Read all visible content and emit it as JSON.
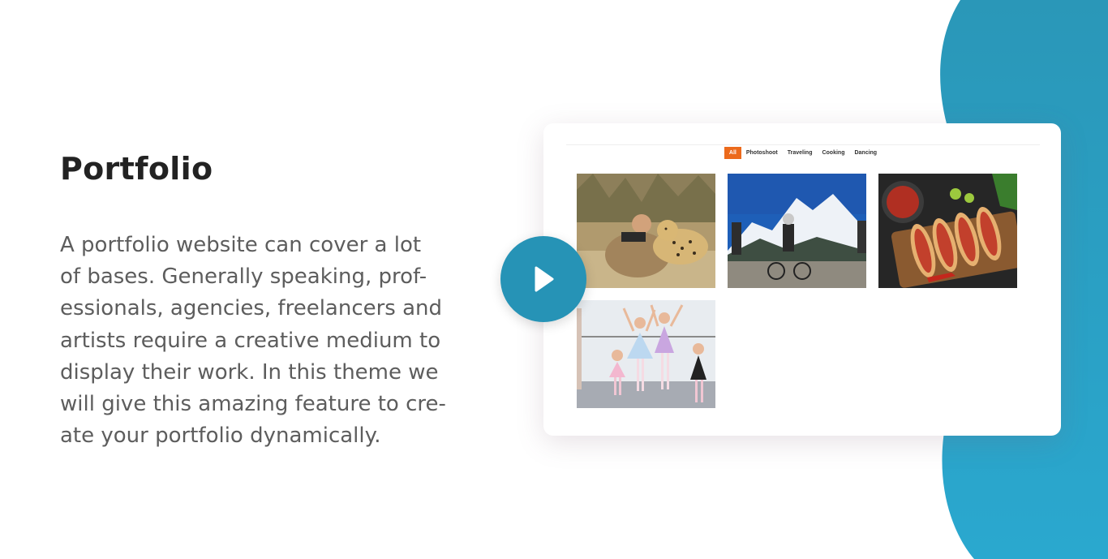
{
  "section": {
    "title": "Portfolio",
    "description_lines": [
      "A portfolio website can cover a lot",
      "of bases. Generally speaking, prof-",
      "essionals, agencies, freelancers and",
      "artists require a creative medium to",
      "display their work. In this theme we",
      "will give this amazing feature to cre-",
      "ate your portfolio dynamically."
    ]
  },
  "preview": {
    "filters": [
      {
        "label": "All",
        "active": true
      },
      {
        "label": "Photoshoot",
        "active": false
      },
      {
        "label": "Traveling",
        "active": false
      },
      {
        "label": "Cooking",
        "active": false
      },
      {
        "label": "Dancing",
        "active": false
      }
    ],
    "items": [
      {
        "subject": "photographer with cheetah"
      },
      {
        "subject": "cyclists in front of snowy mountains"
      },
      {
        "subject": "tacos on wooden board"
      },
      {
        "subject": "children in ballet dance class"
      }
    ]
  },
  "play_button": {
    "icon": "play-icon"
  },
  "colors": {
    "accent_orange": "#ec6a1c",
    "play_blue": "#2693b6",
    "wave_blue": "#2a9fc4",
    "title_text": "#222222",
    "body_text": "#5d5d5d"
  }
}
